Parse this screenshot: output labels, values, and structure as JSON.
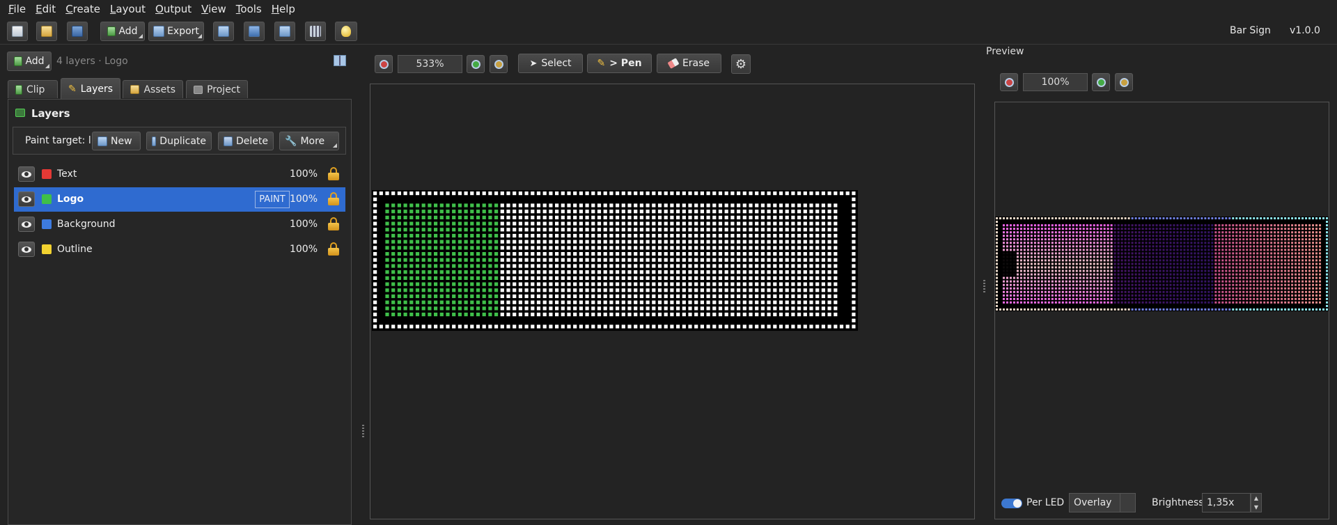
{
  "menu": [
    {
      "first": "F",
      "rest": "ile"
    },
    {
      "first": "E",
      "rest": "dit"
    },
    {
      "first": "C",
      "rest": "reate"
    },
    {
      "first": "L",
      "rest": "ayout"
    },
    {
      "first": "O",
      "rest": "utput"
    },
    {
      "first": "V",
      "rest": "iew"
    },
    {
      "first": "T",
      "rest": "ools"
    },
    {
      "first": "H",
      "rest": "elp"
    }
  ],
  "toolbar": {
    "add_label": "Add",
    "export_label": "Export",
    "app_name": "Bar Sign",
    "version": "v1.0.0"
  },
  "left_panel": {
    "add_label": "Add",
    "summary": "4 layers · Logo",
    "tabs": [
      {
        "label": "Clip"
      },
      {
        "label": "Layers"
      },
      {
        "label": "Assets"
      },
      {
        "label": "Project"
      }
    ],
    "section_title": "Layers",
    "paint_target_label": "Paint target: l",
    "new_label": "New",
    "duplicate_label": "Duplicate",
    "delete_label": "Delete",
    "more_label": "More",
    "layers": [
      {
        "name": "Text",
        "color": "#e53935",
        "opacity": "100%",
        "tag": ""
      },
      {
        "name": "Logo",
        "color": "#3fbf4a",
        "opacity": "100%",
        "tag": "PAINT"
      },
      {
        "name": "Background",
        "color": "#3d7be0",
        "opacity": "100%",
        "tag": ""
      },
      {
        "name": "Outline",
        "color": "#f2d230",
        "opacity": "100%",
        "tag": ""
      }
    ]
  },
  "editor": {
    "zoom": "533%",
    "select_label": "Select",
    "pen_label": "> Pen",
    "erase_label": "Erase"
  },
  "preview": {
    "title": "Preview",
    "zoom": "100%",
    "per_led_label": "Per LED",
    "per_led_on": true,
    "mode": "Overlay",
    "brightness_label": "Brightness",
    "brightness_value": "1,35x"
  },
  "colors": {
    "accent": "#2f6bd0",
    "led_on": "#ffffff",
    "led_logo": "#3fbf4a",
    "preview_border": "#8fe8f0"
  }
}
